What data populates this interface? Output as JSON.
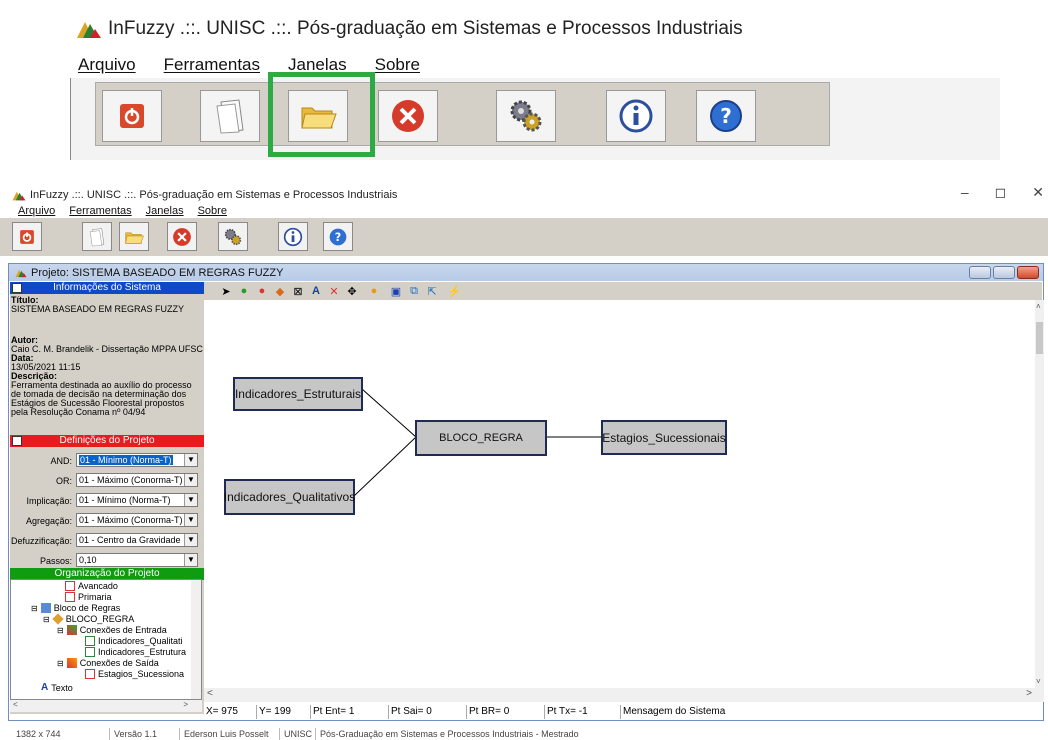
{
  "zoom": {
    "title": "InFuzzy .::. UNISC .::. Pós-graduação em Sistemas e Processos Industriais",
    "menu": [
      "Arquivo",
      "Ferramentas",
      "Janelas",
      "Sobre"
    ]
  },
  "app": {
    "title": "InFuzzy .::. UNISC .::. Pós-graduação em Sistemas e Processos Industriais",
    "menu": [
      "Arquivo",
      "Ferramentas",
      "Janelas",
      "Sobre"
    ],
    "window_controls": [
      "–",
      "◻",
      "✕"
    ]
  },
  "toolbar_icons": [
    "power-icon",
    "new-document-icon",
    "open-folder-icon",
    "close-red-icon",
    "settings-gears-icon",
    "info-icon",
    "help-icon"
  ],
  "project": {
    "window_title": "Projeto: SISTEMA BASEADO EM REGRAS FUZZY",
    "info_header": "Informações do Sistema",
    "titulo_label": "Título:",
    "titulo_value": "SISTEMA BASEADO EM REGRAS FUZZY",
    "autor_label": "Autor:",
    "autor_value": "Caio C. M. Brandelik - Dissertação MPPA UFSC 20",
    "data_label": "Data:",
    "data_value": "13/05/2021 11:15",
    "descricao_label": "Descrição:",
    "descricao_value": "Ferramenta destinada ao auxílio do processo de tomada de decisão na determinação dos Estágios de Sucessão Floorestal propostos pela Resolução Conama nº 04/94",
    "defs_header": "Definições do Projeto",
    "defs": [
      {
        "label": "AND:",
        "value": "01 - Mínimo (Norma-T)"
      },
      {
        "label": "OR:",
        "value": "01 - Máximo (Conorma-T)"
      },
      {
        "label": "Implicação:",
        "value": "01 - Mínimo (Norma-T)"
      },
      {
        "label": "Agregação:",
        "value": "01 - Máximo (Conorma-T)"
      },
      {
        "label": "Defuzzificação:",
        "value": "01 - Centro da Gravidade"
      },
      {
        "label": "Passos:",
        "value": "0,10"
      }
    ],
    "org_header": "Organização do Projeto",
    "tree": [
      "Avancado",
      "Primaria",
      "Bloco de Regras",
      "BLOCO_REGRA",
      "Conexões de Entrada",
      "Indicadores_Qualitati",
      "Indicadores_Estrutura",
      "Conexões de Saída",
      "Estagios_Sucessiona",
      "Texto"
    ]
  },
  "nodes": {
    "estruturais": "Indicadores_Estruturais",
    "qualitativos": "Indicadores_Qualitativos",
    "bloco": "BLOCO_REGRA",
    "estagios": "Estagios_Sucessionais"
  },
  "status": {
    "x": "X= 975",
    "y": "Y= 199",
    "pt_ent": "Pt Ent= 1",
    "pt_sai": "Pt Sai= 0",
    "pt_br": "Pt BR= 0",
    "pt_tx": "Pt Tx= -1",
    "msg": "Mensagem do Sistema"
  },
  "app_status": [
    "1382 x 744",
    "Versão 1.1",
    "Ederson Luis Posselt",
    "UNISC",
    "Pós-Graduação em Sistemas e Processos Industriais - Mestrado"
  ]
}
